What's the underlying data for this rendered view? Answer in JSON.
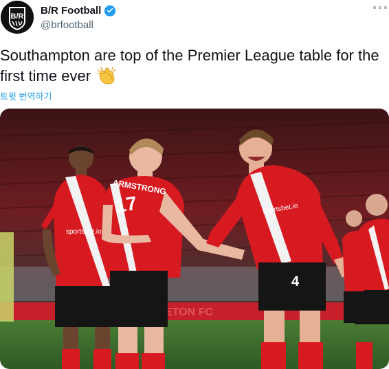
{
  "account": {
    "display_name": "B/R Football",
    "handle": "@brfootball",
    "avatar_text": "B/R",
    "verified_color": "#1d9bf0"
  },
  "tweet": {
    "text": "Southampton are top of the Premier League table for the first time ever",
    "emoji": "clapping-hands",
    "translate_label": "트윗 번역하기"
  },
  "photo": {
    "shirt_names": [
      "ARMSTRONG",
      "17",
      "4"
    ],
    "sponsor": "sportsbet.io",
    "board_text": "ETON FC",
    "colors": {
      "shirt_red": "#d71920",
      "shirt_white": "#f2f2f2",
      "shorts": "#151515",
      "pitch": "#3d6b2e",
      "stands": "#7a1e22"
    }
  }
}
